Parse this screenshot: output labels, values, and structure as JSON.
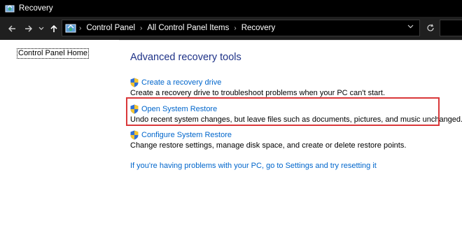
{
  "window": {
    "title": "Recovery"
  },
  "address_bar": {
    "breadcrumbs": [
      "Control Panel",
      "All Control Panel Items",
      "Recovery"
    ],
    "icons": {
      "back": "arrow-left-icon",
      "forward": "arrow-right-icon",
      "recent": "chevron-down-icon",
      "up": "arrow-up-icon",
      "location": "control-panel-icon",
      "dropdown": "chevron-down-icon",
      "refresh": "refresh-icon"
    }
  },
  "sidebar": {
    "home_link": "Control Panel Home"
  },
  "main": {
    "heading": "Advanced recovery tools",
    "tools": [
      {
        "link": "Create a recovery drive",
        "description": "Create a recovery drive to troubleshoot problems when your PC can't start.",
        "icon": "uac-shield-icon"
      },
      {
        "link": "Open System Restore",
        "description": "Undo recent system changes, but leave files such as documents, pictures, and music unchanged.",
        "icon": "uac-shield-icon",
        "highlighted": true
      },
      {
        "link": "Configure System Restore",
        "description": "Change restore settings, manage disk space, and create or delete restore points.",
        "icon": "uac-shield-icon"
      }
    ],
    "reset_link": "If you're having problems with your PC, go to Settings and try resetting it"
  },
  "colors": {
    "titlebar_bg": "#000000",
    "addressbar_bg": "#1f1f1f",
    "heading": "#1e3287",
    "link": "#0066cc",
    "highlight_border": "#d9383a"
  }
}
